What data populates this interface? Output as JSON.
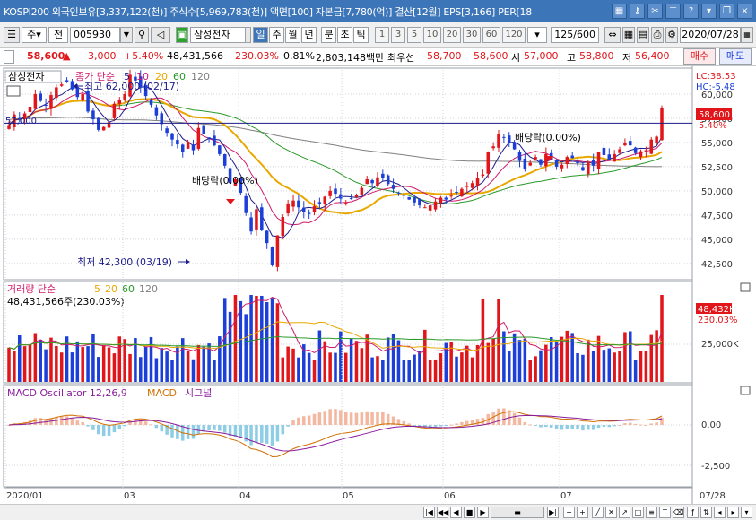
{
  "titlebar": {
    "text": "KOSPI200 외국인보유[3,337,122(천)] 주식수[5,969,783(천)] 액면[100] 자본금[7,780(억)] 결산[12월] EPS[3,166] PER[18",
    "icons": [
      "grid-icon",
      "key-icon",
      "scissors-icon",
      "pin-icon",
      "help-icon",
      "dropdown-icon",
      "restore-icon",
      "close-icon"
    ]
  },
  "toolbar": {
    "period_sel": "주",
    "mode_sel": "전",
    "code": "005930",
    "stock_name": "삼성전자",
    "timeframes": [
      "일",
      "주",
      "월",
      "년",
      "분",
      "초",
      "틱"
    ],
    "active_timeframe": "일",
    "minutes": [
      "1",
      "3",
      "5",
      "10",
      "20",
      "30",
      "60",
      "120"
    ],
    "count": "125/600",
    "date": "2020/07/28"
  },
  "pricebar": {
    "price": "58,600",
    "change": "3,000",
    "rate": "+5.40%",
    "volume": "48,431,566",
    "vol_rate": "230.03%",
    "turnover": "0.81%",
    "amount": "2,803,148백만",
    "best_ask_label": "최우선",
    "best_ask": "58,700",
    "best_bid": "58,600",
    "open_label": "시",
    "open": "57,000",
    "high_label": "고",
    "high": "58,800",
    "low_label": "저",
    "low": "56,400",
    "buy": "매수",
    "sell": "매도"
  },
  "price_panel": {
    "name": "삼성전자",
    "legend_label": "종가 단순",
    "legend_periods": [
      "5",
      "10",
      "20",
      "60",
      "120"
    ],
    "lc": "LC:38.53",
    "hc": "HC:-5.48",
    "y_ticks": [
      "60,000",
      "57,500",
      "55,000",
      "52,500",
      "50,000",
      "47,500",
      "45,000",
      "42,500"
    ],
    "current_price": "58,600",
    "current_rate": "5.40%",
    "ref_price": "57,000",
    "high_annot": "최고 62,000 (02/17)",
    "low_annot": "최저 42,300 (03/19)",
    "div1": "배당락(0.00%)",
    "div2": "배당락(0.00%)"
  },
  "volume_panel": {
    "legend_label": "거래량 단순",
    "legend_periods": [
      "5",
      "20",
      "60",
      "120"
    ],
    "value_line": "48,431,566주(230.03%)",
    "current": "48,432K",
    "current_rate": "230.03%",
    "y_tick": "25,000K"
  },
  "macd_panel": {
    "osc_label": "MACD Oscillator 12,26,9",
    "macd_label": "MACD",
    "signal_label": "시그널",
    "y_ticks": [
      "0.00",
      "-2,500"
    ]
  },
  "x_axis": {
    "labels": [
      "2020/01",
      "03",
      "04",
      "05",
      "06",
      "07"
    ],
    "right_label": "07/28"
  },
  "colors": {
    "up": "#e0161b",
    "down": "#1b3fd8",
    "ma5": "#1c1c8c",
    "ma10": "#d01b6a",
    "ma20": "#e8a800",
    "ma60": "#2a9a2a",
    "ma120": "#808080",
    "title": "#3d76b8"
  },
  "chart_data": {
    "type": "candlestick",
    "closes": [
      56800,
      57900,
      57500,
      58000,
      58700,
      60000,
      59300,
      58800,
      59900,
      60700,
      61000,
      61300,
      60500,
      59700,
      60000,
      58200,
      57400,
      56300,
      56600,
      57100,
      59000,
      59400,
      60000,
      62000,
      61400,
      60700,
      59800,
      58900,
      57800,
      56900,
      56000,
      55300,
      54800,
      54000,
      55100,
      54200,
      56500,
      55900,
      55400,
      54700,
      53800,
      52600,
      50800,
      51200,
      49800,
      47700,
      45800,
      48100,
      46000,
      44600,
      42300,
      45400,
      47300,
      48700,
      49000,
      48300,
      47800,
      47600,
      48400,
      48700,
      49400,
      50000,
      49700,
      49200,
      48800,
      49200,
      49600,
      50300,
      51200,
      50800,
      51400,
      51300,
      50700,
      50200,
      49800,
      49500,
      49100,
      48800,
      48500,
      48300,
      48500,
      48900,
      49300,
      49100,
      49500,
      49800,
      50200,
      50500,
      50800,
      51300,
      51700,
      54000,
      54600,
      55900,
      55500,
      54900,
      54300,
      53100,
      52300,
      52900,
      53500,
      52700,
      53800,
      53200,
      52500,
      52700,
      53500,
      53400,
      52900,
      52100,
      53000,
      52600,
      54000,
      53700,
      53200,
      53800,
      54300,
      55000,
      54700,
      53900,
      54100,
      54200,
      55300,
      55600,
      58600
    ],
    "series": [
      {
        "name": "종가 단순 5",
        "values": []
      },
      {
        "name": "10",
        "values": []
      },
      {
        "name": "20",
        "values": []
      },
      {
        "name": "60",
        "values": []
      },
      {
        "name": "120",
        "values": []
      }
    ],
    "volume_note": "48,431,566주",
    "y_range": [
      41000,
      62500
    ]
  }
}
